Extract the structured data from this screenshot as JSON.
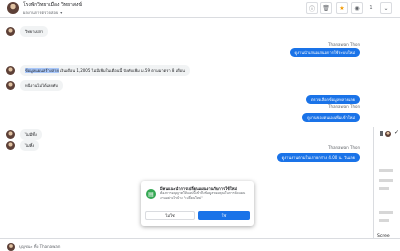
{
  "header": {
    "title": "โรงพักวิทยาเมือง วิทยาสงฆ์",
    "subtitle": "ผลงานการตรวจสอบ",
    "count": "1",
    "icons": [
      "info-icon",
      "trash-icon",
      "star-icon",
      "chat-icon",
      "chevron-down-icon"
    ]
  },
  "messages": {
    "m1": "วิทยาเปล่า",
    "m1b_sender": "Thanawan Thon",
    "m1b": "ดูงานนำเสนอเสนอการใช้ระบบใหม่",
    "m2_highlight": "ข้อมูลแผนสร้างสาย",
    "m2_rest": " เงินเดือน 1,2005 ไม่มีเพิ่มในเดือนนี้ บังคับเพิ่ม ม.59 ตามมาตรา 8 เดือน",
    "m3": "หนีงานไม่ได้เลยคับ",
    "m3b_sender": "Thanawan Thon",
    "m3b1": "ตรวจเลือกข้อมูลหลายเลย",
    "m3b2": "ดูงานของตนเองเพิ่มเข้าใหม่",
    "m4": "ไม่มีทิ้ง",
    "m4b_sender": "Thanawan Thon",
    "m4b": "ดูงานงานตามในเรายกร่าง 4.00 น. วันเลย",
    "m5": "ไม่ทิ้ง"
  },
  "dialog": {
    "title": "มีคนแนะนำการเปลี่ยนแผนงานกับการใช้ใหม่",
    "body": "ต้องการอนุญาตให้แอปนี้เข้าถึงข้อมูลของคุณในการจัดแผนงานอย่างไรบ้าง \"เปลี่ยนใหม่\"",
    "no_label": "ไม่ใช่",
    "yes_label": "ใช่"
  },
  "side_panel": {
    "text_line1": "Scree",
    "text_line2": "Scree"
  },
  "footer": {
    "text": "บุญชนะ ทิ้ง Thanawan"
  }
}
